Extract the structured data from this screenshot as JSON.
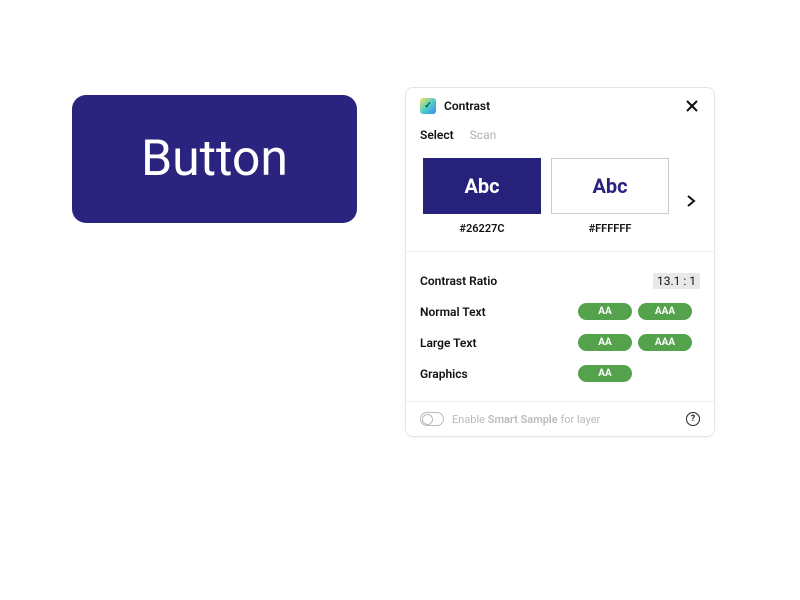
{
  "element": {
    "label": "Button"
  },
  "panel": {
    "title": "Contrast",
    "tabs": {
      "select": "Select",
      "scan": "Scan"
    },
    "foreground": {
      "sample": "Abc",
      "hex": "#26227C"
    },
    "background": {
      "sample": "Abc",
      "hex": "#FFFFFF"
    },
    "ratio": {
      "label": "Contrast Ratio",
      "value": "13.1 : 1"
    },
    "normal": {
      "label": "Normal Text",
      "aa": "AA",
      "aaa": "AAA"
    },
    "large": {
      "label": "Large Text",
      "aa": "AA",
      "aaa": "AAA"
    },
    "graphics": {
      "label": "Graphics",
      "aa": "AA"
    },
    "footer": {
      "prefix": "Enable ",
      "bold": "Smart Sample",
      "suffix": " for layer"
    }
  }
}
